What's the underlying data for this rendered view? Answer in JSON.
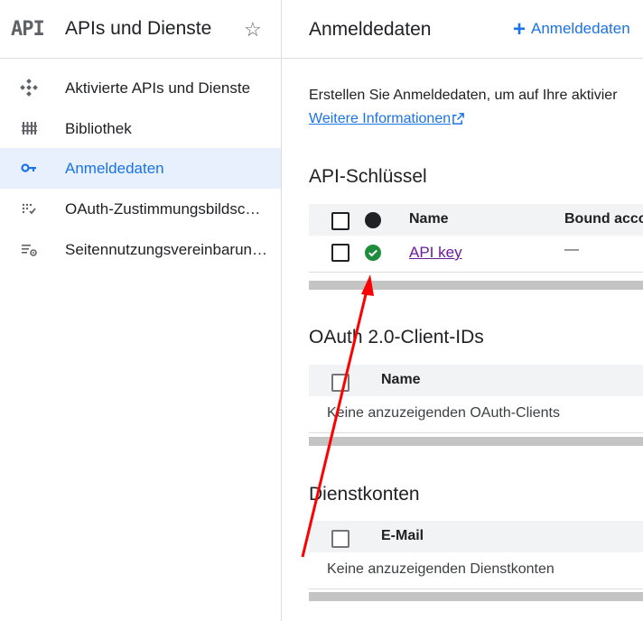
{
  "sidebar": {
    "logo": "API",
    "title": "APIs und Dienste",
    "items": [
      {
        "label": "Aktivierte APIs und Dienste",
        "icon": "apis-services-icon"
      },
      {
        "label": "Bibliothek",
        "icon": "library-icon"
      },
      {
        "label": "Anmeldedaten",
        "icon": "key-icon",
        "active": true
      },
      {
        "label": "OAuth-Zustimmungsbildschirm",
        "icon": "oauth-consent-icon"
      },
      {
        "label": "Seitennutzungsvereinbarungen",
        "icon": "page-usage-settings-icon"
      }
    ]
  },
  "main": {
    "title": "Anmeldedaten",
    "create_label": "Anmeldedaten",
    "intro": "Erstellen Sie Anmeldedaten, um auf Ihre aktivier",
    "learn_more": "Weitere Informationen"
  },
  "api_keys": {
    "title": "API-Schlüssel",
    "col_name": "Name",
    "col_bound": "Bound acco",
    "rows": [
      {
        "name": "API key",
        "bound": "—",
        "status": "ok"
      }
    ]
  },
  "oauth": {
    "title": "OAuth 2.0-Client-IDs",
    "col_name": "Name",
    "empty": "Keine anzuzeigenden OAuth-Clients"
  },
  "service_accounts": {
    "title": "Dienstkonten",
    "col_email": "E-Mail",
    "empty": "Keine anzuzeigenden Dienstkonten"
  },
  "colors": {
    "accent": "#1a73e8",
    "active_bg": "#e8f0fe",
    "ok_green": "#1e8e3e",
    "annotation_arrow": "#ff0000",
    "link_visited": "#6a1b9a"
  }
}
